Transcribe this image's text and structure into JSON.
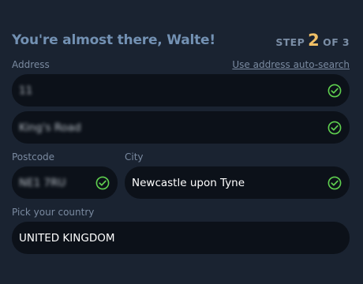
{
  "header": {
    "title": "You're almost there, Walte!",
    "step_prefix": "STEP",
    "step_current": "2",
    "step_suffix": "OF 3"
  },
  "address": {
    "label": "Address",
    "autosearch_link": "Use address auto-search",
    "line1_value": "11",
    "line2_value": "King's Road"
  },
  "postcode": {
    "label": "Postcode",
    "value": "NE1 7RU"
  },
  "city": {
    "label": "City",
    "value": "Newcastle upon Tyne"
  },
  "country": {
    "label": "Pick your country",
    "value": "UNITED KINGDOM"
  },
  "icons": {
    "valid": "check-circle-icon"
  },
  "colors": {
    "background": "#1a2331",
    "field_background": "#0c1119",
    "accent_step": "#f0bf66",
    "valid_green": "#5fd04f",
    "title": "#7391b3"
  }
}
